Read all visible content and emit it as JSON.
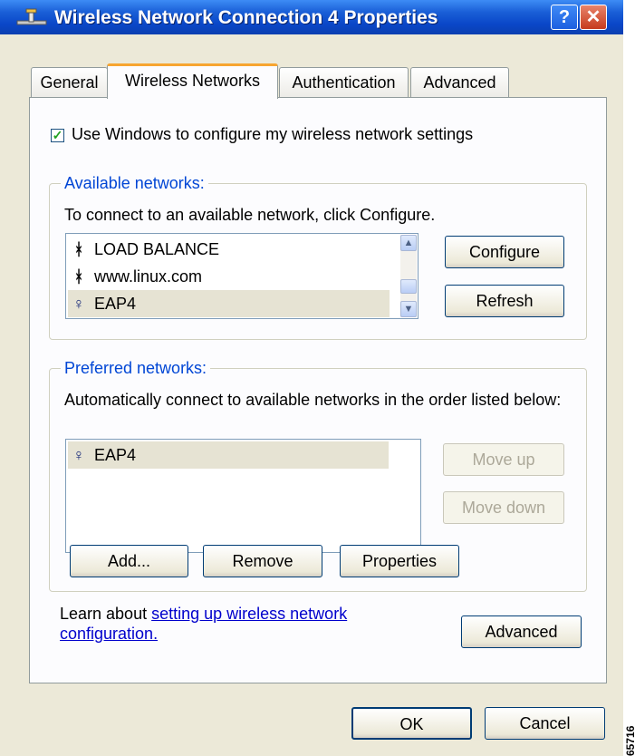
{
  "window": {
    "title": "Wireless Network Connection 4 Properties",
    "help_label": "?",
    "close_label": "✕"
  },
  "tabs": [
    {
      "label": "General",
      "active": false
    },
    {
      "label": "Wireless Networks",
      "active": true
    },
    {
      "label": "Authentication",
      "active": false
    },
    {
      "label": "Advanced",
      "active": false
    }
  ],
  "use_windows": {
    "label": "Use Windows to configure my wireless network settings",
    "checked": true
  },
  "available": {
    "group_label": "Available networks:",
    "instruction": "To connect to an available network, click Configure.",
    "items": [
      {
        "name": "LOAD BALANCE",
        "icon": "antenna-icon"
      },
      {
        "name": "www.linux.com",
        "icon": "antenna-icon"
      },
      {
        "name": "EAP4",
        "icon": "preferred-network-icon",
        "selected": true
      }
    ],
    "configure_label": "Configure",
    "refresh_label": "Refresh"
  },
  "preferred": {
    "group_label": "Preferred networks:",
    "instruction": "Automatically connect to available networks in the order listed below:",
    "items": [
      {
        "name": "EAP4",
        "icon": "preferred-network-icon",
        "selected": true
      }
    ],
    "move_up_label": "Move up",
    "move_down_label": "Move down",
    "add_label": "Add...",
    "remove_label": "Remove",
    "properties_label": "Properties"
  },
  "learn": {
    "prefix": "Learn about ",
    "link_line1": "setting up wireless network",
    "link_line2": "configuration."
  },
  "advanced_button_label": "Advanced",
  "footer": {
    "ok_label": "OK",
    "cancel_label": "Cancel"
  },
  "side_mark": "65716",
  "colors": {
    "titlebar": "#0a47c8",
    "group_label": "#0046d5",
    "link": "#0000cc",
    "check": "#21a121"
  }
}
